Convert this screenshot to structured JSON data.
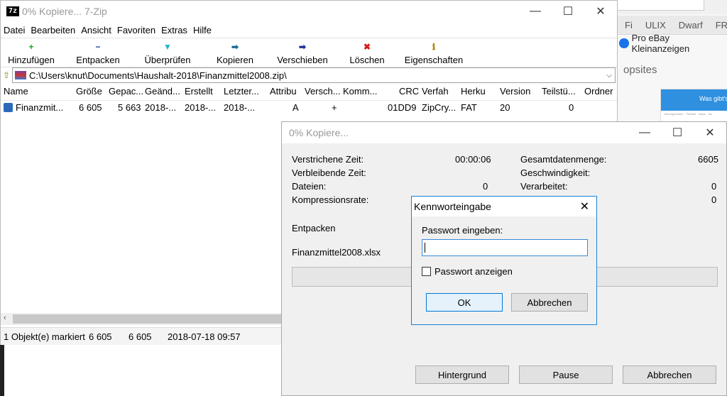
{
  "browser": {
    "tabs": [
      "Fi",
      "ULIX",
      "Dwarf",
      "FRI"
    ],
    "bookmark": "Pro eBay Kleinanzeigen",
    "section": "opsites",
    "card_title": "Was gibt's",
    "card_nav": [
      "Hervorgehoben",
      "Fußball",
      "News",
      "Bu"
    ]
  },
  "main": {
    "title": "0% Kopiere... 7-Zip",
    "app_icon": "7z",
    "menu": [
      "Datei",
      "Bearbeiten",
      "Ansicht",
      "Favoriten",
      "Extras",
      "Hilfe"
    ],
    "toolbar": [
      {
        "label": "Hinzufügen",
        "icon": "+",
        "color": "#18a81a"
      },
      {
        "label": "Entpacken",
        "icon": "−",
        "color": "#1c3aa9"
      },
      {
        "label": "Überprüfen",
        "icon": "▼",
        "color": "#27b3c9"
      },
      {
        "label": "Kopieren",
        "icon": "➡",
        "color": "#1d6b8f"
      },
      {
        "label": "Verschieben",
        "icon": "➡",
        "color": "#1c2f9a"
      },
      {
        "label": "Löschen",
        "icon": "✖",
        "color": "#d61a1a"
      },
      {
        "label": "Eigenschaften",
        "icon": "ℹ",
        "color": "#b08a00"
      }
    ],
    "address": "C:\\Users\\knut\\Documents\\Haushalt-2018\\Finanzmittel2008.zip\\",
    "columns": [
      "Name",
      "Größe",
      "Gepac...",
      "Geänd...",
      "Erstellt",
      "Letzter...",
      "Attribu",
      "Versch...",
      "Komm...",
      "CRC",
      "Verfah",
      "Herku",
      "Version",
      "Teilstü...",
      "Ordner"
    ],
    "row": {
      "name": "Finanzmit...",
      "size": "6 605",
      "packed": "5 663",
      "modified": "2018-...",
      "created": "2018-...",
      "accessed": "2018-...",
      "attributes": "A",
      "encrypted": "+",
      "crc": "01DD9",
      "method": "ZipCry...",
      "host_os": "FAT",
      "version": "20",
      "volume": "0"
    },
    "status": {
      "selected": "1 Objekt(e) markiert",
      "size": "6 605",
      "packed": "6 605",
      "date": "2018-07-18 09:57"
    }
  },
  "progress": {
    "title": "0% Kopiere...",
    "labels": {
      "elapsed": "Verstrichene Zeit:",
      "remaining": "Verbleibende Zeit:",
      "files": "Dateien:",
      "ratio": "Kompressionsrate:",
      "total": "Gesamtdatenmenge:",
      "speed": "Geschwindigkeit:",
      "processed": "Verarbeitet:"
    },
    "values": {
      "elapsed": "00:00:06",
      "files": "0",
      "total": "6605",
      "processed": "0",
      "row4_right": "0"
    },
    "operation": "Entpacken",
    "current_file": "Finanzmittel2008.xlsx",
    "percent": 0,
    "buttons": {
      "background": "Hintergrund",
      "pause": "Pause",
      "cancel": "Abbrechen"
    }
  },
  "password_dialog": {
    "title": "Kennworteingabe",
    "prompt": "Passwort eingeben:",
    "value": "",
    "show_password": "Passwort anzeigen",
    "ok": "OK",
    "cancel": "Abbrechen"
  }
}
